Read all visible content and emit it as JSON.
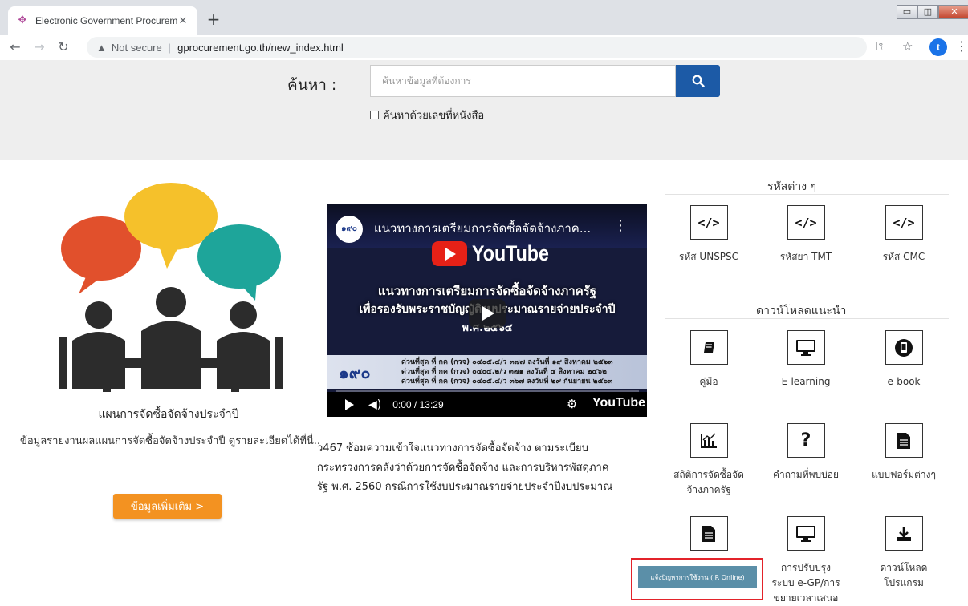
{
  "browser": {
    "tab_title": "Electronic Government Procurem",
    "not_secure": "Not secure",
    "url": "gprocurement.go.th/new_index.html",
    "profile_initial": "t"
  },
  "search": {
    "label": "ค้นหา :",
    "placeholder": "ค้นหาข้อมูลที่ต้องการ",
    "checkbox_label": "ค้นหาด้วยเลขที่หนังสือ"
  },
  "plan": {
    "title": "แผนการจัดซื้อจัดจ้างประจำปี",
    "desc": "ข้อมูลรายงานผลแผนการจัดซื้อจัดจ้างประจำปี ดูรายละเอียดได้ที่นี่..",
    "button": "ข้อมูลเพิ่มเติม >"
  },
  "video": {
    "channel_logo": "๑๙๐",
    "title": "แนวทางการเตรียมการจัดซื้อจัดจ้างภาค...",
    "youtube_word": "YouTube",
    "line1": "แนวทางการเตรียมการจัดซื้อจัดจ้างภาครัฐ",
    "line2": "เพื่อรองรับพระราชบัญญัติงบประมาณรายจ่ายประจำปี",
    "line3": "พ.ศ.๒๕๖๔",
    "band_logo": "๑๙๐",
    "band_lines": [
      "ด่วนที่สุด ที่ กค (กวจ) ๐๔๐๕.๔/ว ๓๗๗ ลงวันที่ ๑๙ สิงหาคม ๒๕๖๓",
      "ด่วนที่สุด ที่ กค (กวจ) ๐๔๐๕.๒/ว ๓๗๑ ลงวันที่ ๕ สิงหาคม ๒๕๖๒",
      "ด่วนที่สุด ที่ กค (กวจ) ๐๔๐๕.๔/ว ๓๖๗ ลงวันที่ ๒๙ กันยายน ๒๕๖๓"
    ],
    "time": "0:00 / 13:29",
    "brand": "YouTube"
  },
  "article": {
    "lines": [
      "ว467 ซ้อมความเข้าใจแนวทางการจัดซื้อจัดจ้าง ตามระเบียบ",
      "กระทรวงการคลังว่าด้วยการจัดซื้อจัดจ้าง และการบริหารพัสดุภาค",
      "รัฐ พ.ศ. 2560 กรณีการใช้งบประมาณรายจ่ายประจำปีงบประมาณ"
    ]
  },
  "codes": {
    "heading": "รหัสต่าง ๆ",
    "items": [
      {
        "label": "รหัส UNSPSC",
        "icon": "code-icon"
      },
      {
        "label": "รหัสยา TMT",
        "icon": "code-icon"
      },
      {
        "label": "รหัส CMC",
        "icon": "code-icon"
      }
    ]
  },
  "downloads": {
    "heading": "ดาวน์โหลดแนะนำ",
    "items": [
      {
        "label": "คู่มือ",
        "icon": "book-icon"
      },
      {
        "label": "E-learning",
        "icon": "monitor-icon"
      },
      {
        "label": "e-book",
        "icon": "tablet-icon"
      },
      {
        "label": "สถิติการจัดซื้อจัดจ้างภาครัฐ",
        "icon": "chart-icon"
      },
      {
        "label": "คำถามที่พบบ่อย",
        "icon": "question-icon"
      },
      {
        "label": "แบบฟอร์มต่างๆ",
        "icon": "form-icon"
      },
      {
        "label": "",
        "icon": "document-icon"
      },
      {
        "label": "การปรับปรุงระบบ e-GP/การขยายเวลาเสนอ",
        "icon": "monitor-icon"
      },
      {
        "label": "ดาวน์โหลดโปรแกรม",
        "icon": "download-icon"
      }
    ]
  },
  "ir_banner": {
    "label": "แจ้งปัญหาการใช้งาน (IR Online)"
  },
  "colors": {
    "search_button": "#1c5aa6",
    "more_button": "#f39221",
    "highlight": "#e3232a",
    "ir_banner": "#5b8fa8"
  }
}
